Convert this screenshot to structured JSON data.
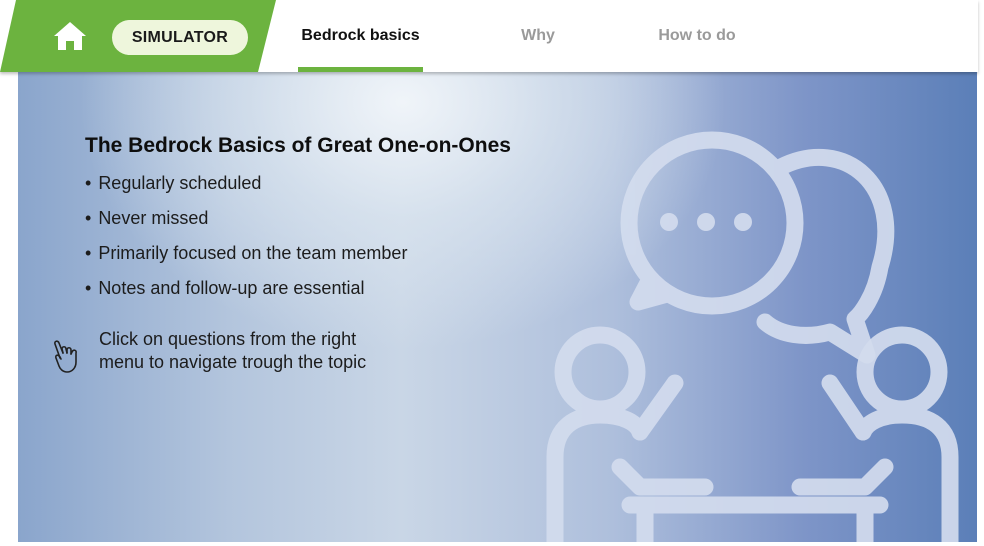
{
  "colors": {
    "brand_green": "#6cb33f",
    "pill_bg": "#eef6dc",
    "tab_active": "#111111",
    "tab_inactive": "#9a9a9a",
    "illustration": "#d3dcee"
  },
  "header": {
    "home_icon": "home-icon",
    "simulator_label": "SIMULATOR",
    "tabs": [
      {
        "label": "Bedrock basics",
        "active": true
      },
      {
        "label": "Why",
        "active": false
      },
      {
        "label": "How to do",
        "active": false
      }
    ]
  },
  "main": {
    "title": "The Bedrock Basics of Great One-on-Ones",
    "bullets": [
      "Regularly scheduled",
      "Never missed",
      "Primarily focused on the team member",
      "Notes and follow-up are essential"
    ],
    "hint": {
      "icon": "pointing-hand-icon",
      "line1": "Click on questions from the right",
      "line2": "menu to navigate trough  the topic"
    },
    "illustration_icon": "one-on-one-meeting-icon"
  }
}
